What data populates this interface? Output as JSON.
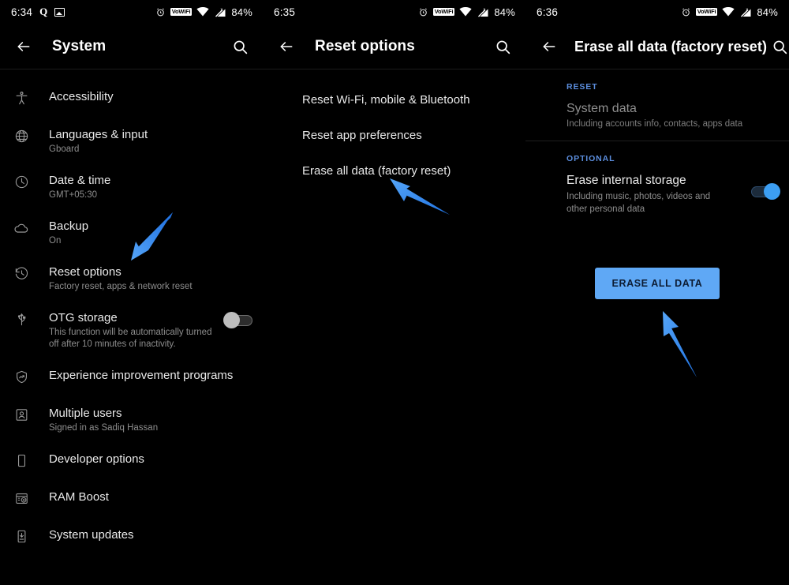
{
  "panels": [
    {
      "id": "system-settings",
      "status_bar": {
        "time": "6:34",
        "left_icons": [
          "quick-q-icon",
          "photo-icon"
        ],
        "right_icons": [
          "alarm-icon",
          "vowifi-icon",
          "wifi-icon",
          "signal-icon"
        ],
        "vowifi_label": "VoWiFi",
        "battery": "84%"
      },
      "app_bar": {
        "back_label": "Back",
        "title": "System",
        "search_label": "Search"
      },
      "items": [
        {
          "icon": "accessibility-icon",
          "title": "Accessibility",
          "subtitle": ""
        },
        {
          "icon": "globe-icon",
          "title": "Languages & input",
          "subtitle": "Gboard"
        },
        {
          "icon": "clock-icon",
          "title": "Date & time",
          "subtitle": "GMT+05:30"
        },
        {
          "icon": "cloud-icon",
          "title": "Backup",
          "subtitle": "On"
        },
        {
          "icon": "history-restore-icon",
          "title": "Reset options",
          "subtitle": "Factory reset, apps & network reset"
        },
        {
          "icon": "usb-icon",
          "title": "OTG storage",
          "subtitle": "This function will be automatically turned off after 10 minutes of inactivity.",
          "toggle": "off"
        },
        {
          "icon": "shield-chart-icon",
          "title": "Experience improvement programs",
          "subtitle": ""
        },
        {
          "icon": "user-card-icon",
          "title": "Multiple users",
          "subtitle": "Signed in as Sadiq Hassan"
        },
        {
          "icon": "phone-icon",
          "title": "Developer options",
          "subtitle": ""
        },
        {
          "icon": "ram-boost-icon",
          "title": "RAM Boost",
          "subtitle": ""
        },
        {
          "icon": "system-update-icon",
          "title": "System updates",
          "subtitle": ""
        }
      ]
    },
    {
      "id": "reset-options",
      "status_bar": {
        "time": "6:35",
        "vowifi_label": "VoWiFi",
        "battery": "84%"
      },
      "app_bar": {
        "back_label": "Back",
        "title": "Reset options",
        "search_label": "Search"
      },
      "items": [
        {
          "title": "Reset Wi-Fi, mobile & Bluetooth"
        },
        {
          "title": "Reset app preferences"
        },
        {
          "title": "Erase all data (factory reset)"
        }
      ]
    },
    {
      "id": "erase-all-data",
      "status_bar": {
        "time": "6:36",
        "vowifi_label": "VoWiFi",
        "battery": "84%"
      },
      "app_bar": {
        "back_label": "Back",
        "title": "Erase all data (factory reset)",
        "search_label": "Search"
      },
      "reset_section": {
        "header": "RESET",
        "title": "System data",
        "subtitle": "Including accounts info, contacts, apps data"
      },
      "optional_section": {
        "header": "OPTIONAL",
        "title": "Erase internal storage",
        "subtitle": "Including music, photos, videos and other personal data",
        "toggle": "on"
      },
      "erase_button": "ERASE ALL DATA"
    }
  ],
  "annotations": {
    "arrow_color": "#2e8bf0",
    "arrow_color_light": "#54a2f7",
    "arrows": [
      {
        "name": "arrow-to-reset-options",
        "points_to": "Reset options"
      },
      {
        "name": "arrow-to-erase-all-data",
        "points_to": "Erase all data (factory reset)"
      },
      {
        "name": "arrow-to-erase-button",
        "points_to": "ERASE ALL DATA"
      }
    ]
  },
  "theme": {
    "background": "#000000",
    "accent_blue": "#5c8ede",
    "button_blue": "#5fa8f5",
    "toggle_on": "#3c9ef2"
  }
}
